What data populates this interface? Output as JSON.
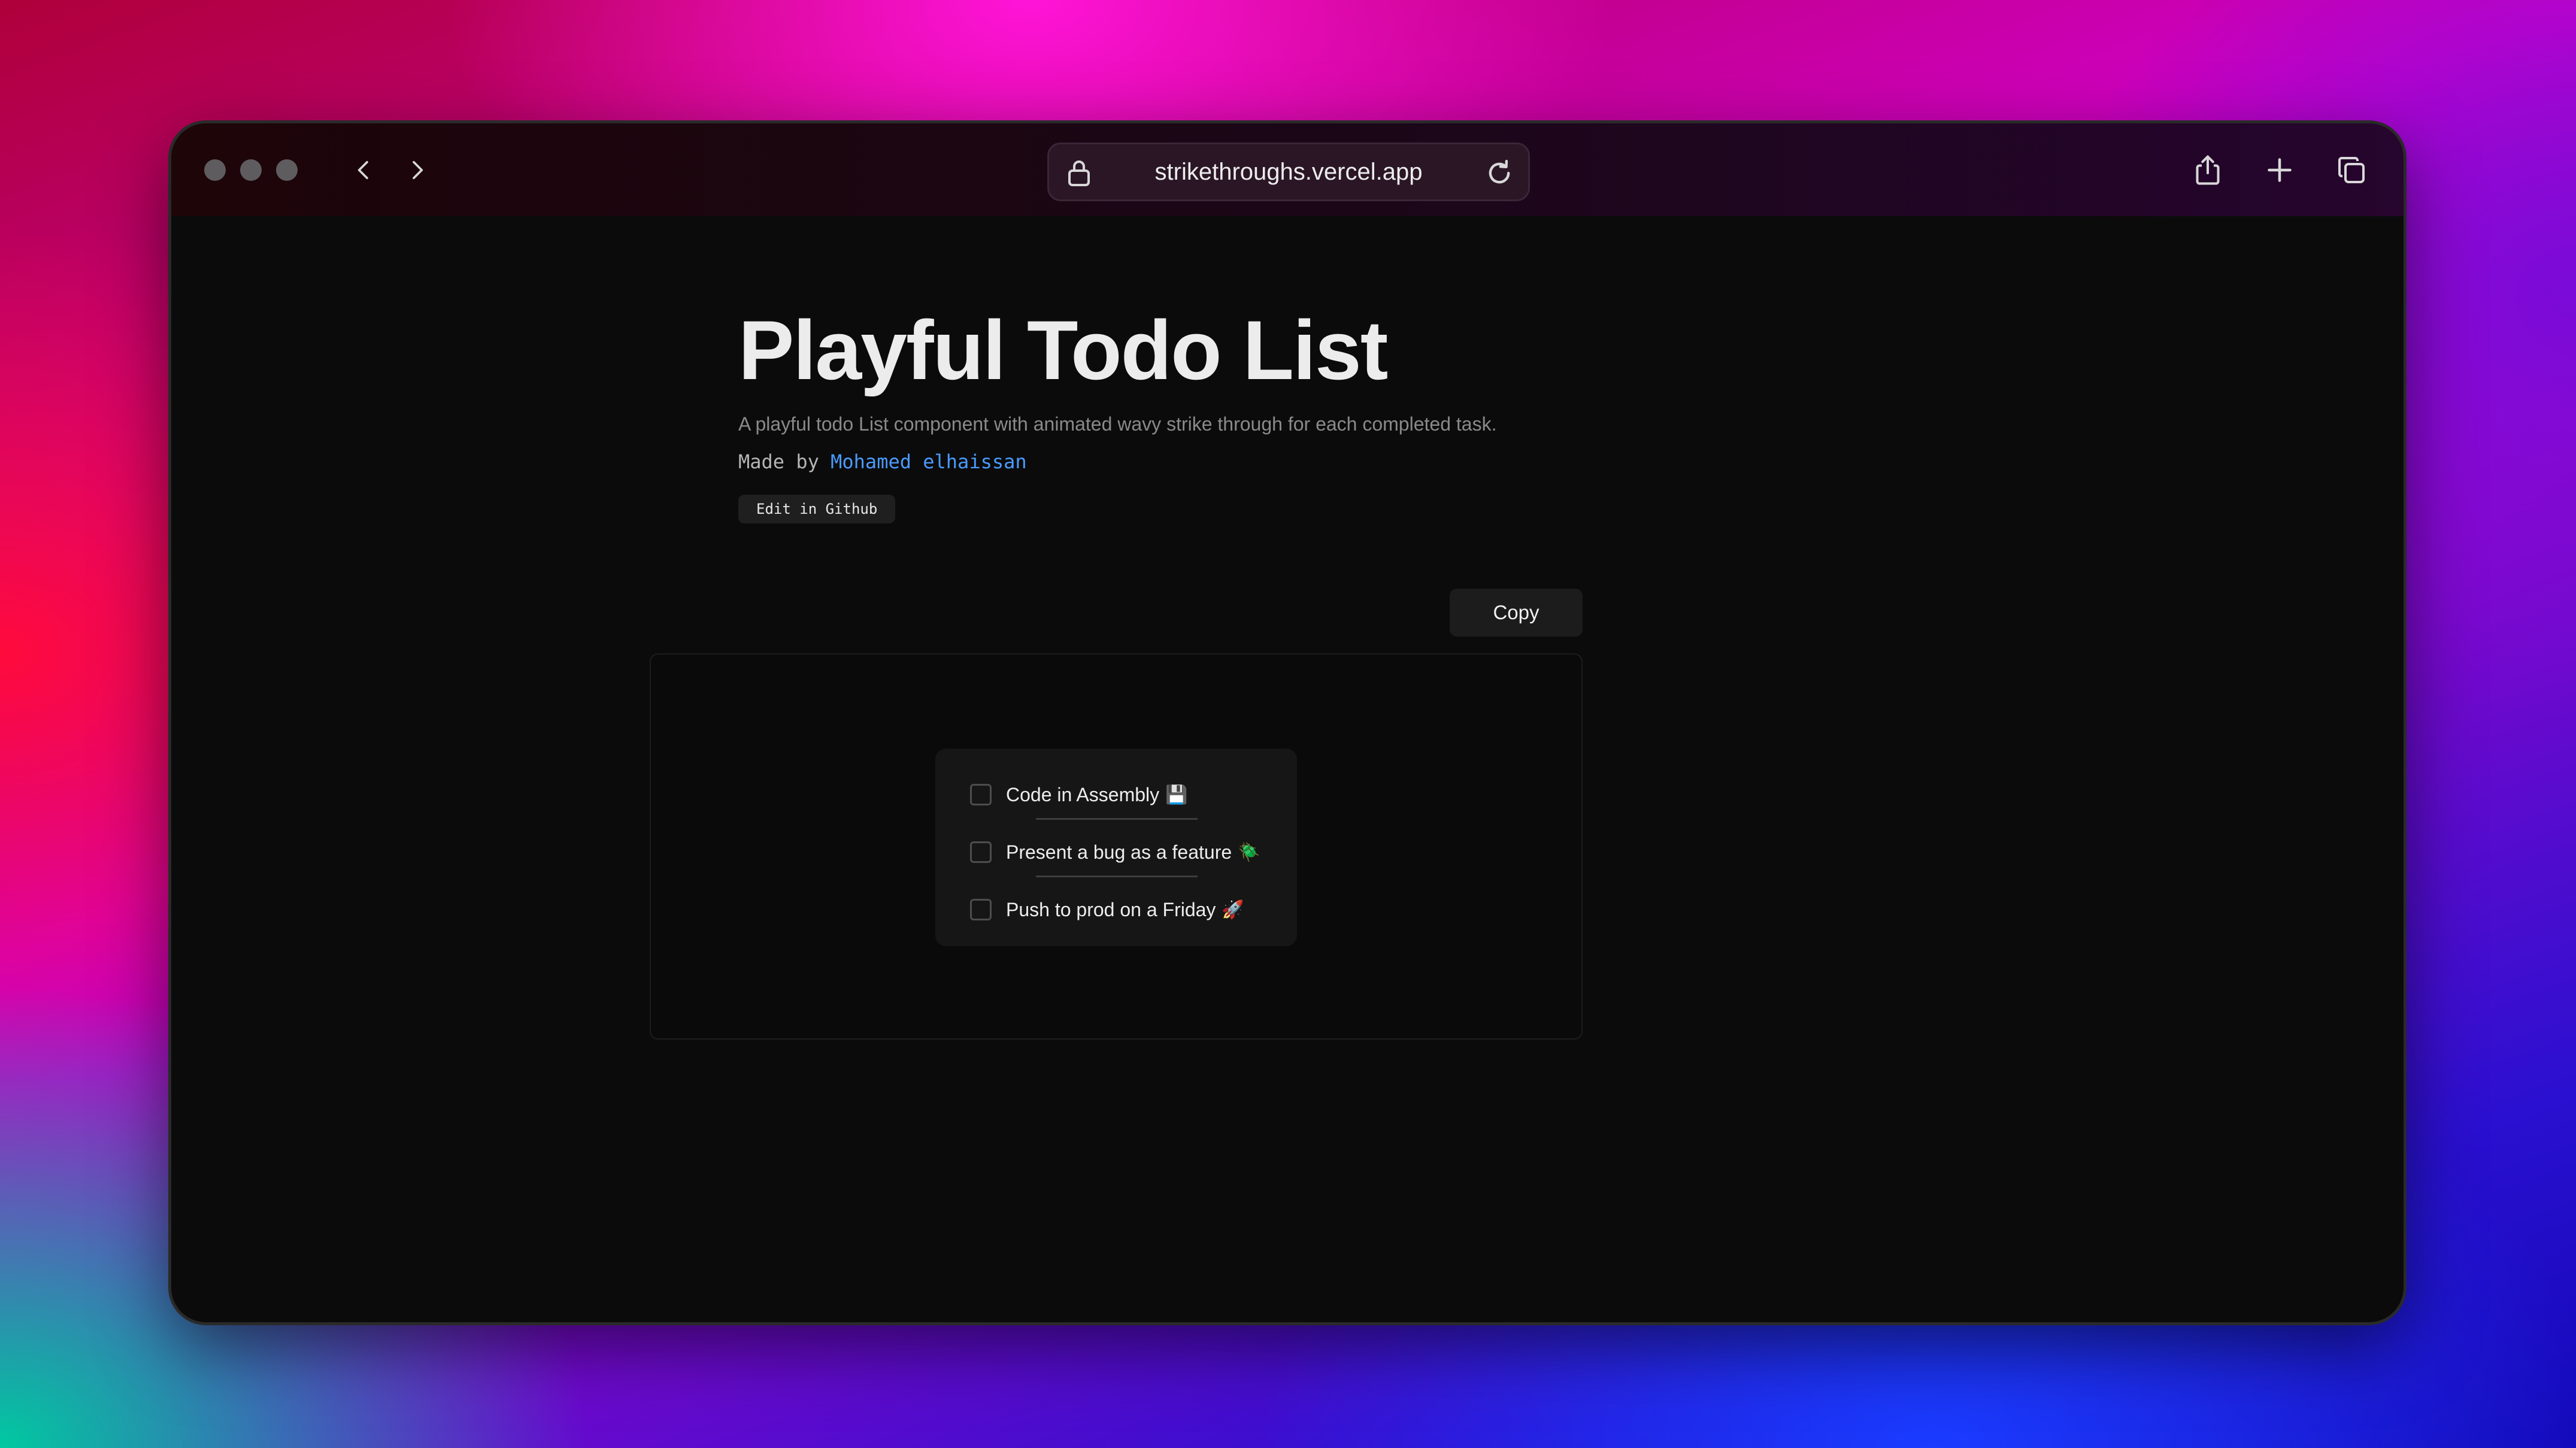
{
  "browser": {
    "url": "strikethroughs.vercel.app"
  },
  "page": {
    "title": "Playful Todo List",
    "subtitle": "A playful todo List component with animated wavy strike through for each completed task.",
    "made_by_prefix": "Made by",
    "author": "Mohamed elhaissan",
    "github_button": "Edit in Github",
    "copy_button": "Copy"
  },
  "todos": [
    {
      "label": "Code in Assembly",
      "emoji": "💾",
      "checked": false
    },
    {
      "label": "Present a bug as a feature",
      "emoji": "🪲",
      "checked": false
    },
    {
      "label": "Push to prod on a Friday",
      "emoji": "🚀",
      "checked": false
    }
  ],
  "colors": {
    "accent_link": "#4a9bff",
    "page_background": "#0b0b0b",
    "card_background": "#161616"
  }
}
